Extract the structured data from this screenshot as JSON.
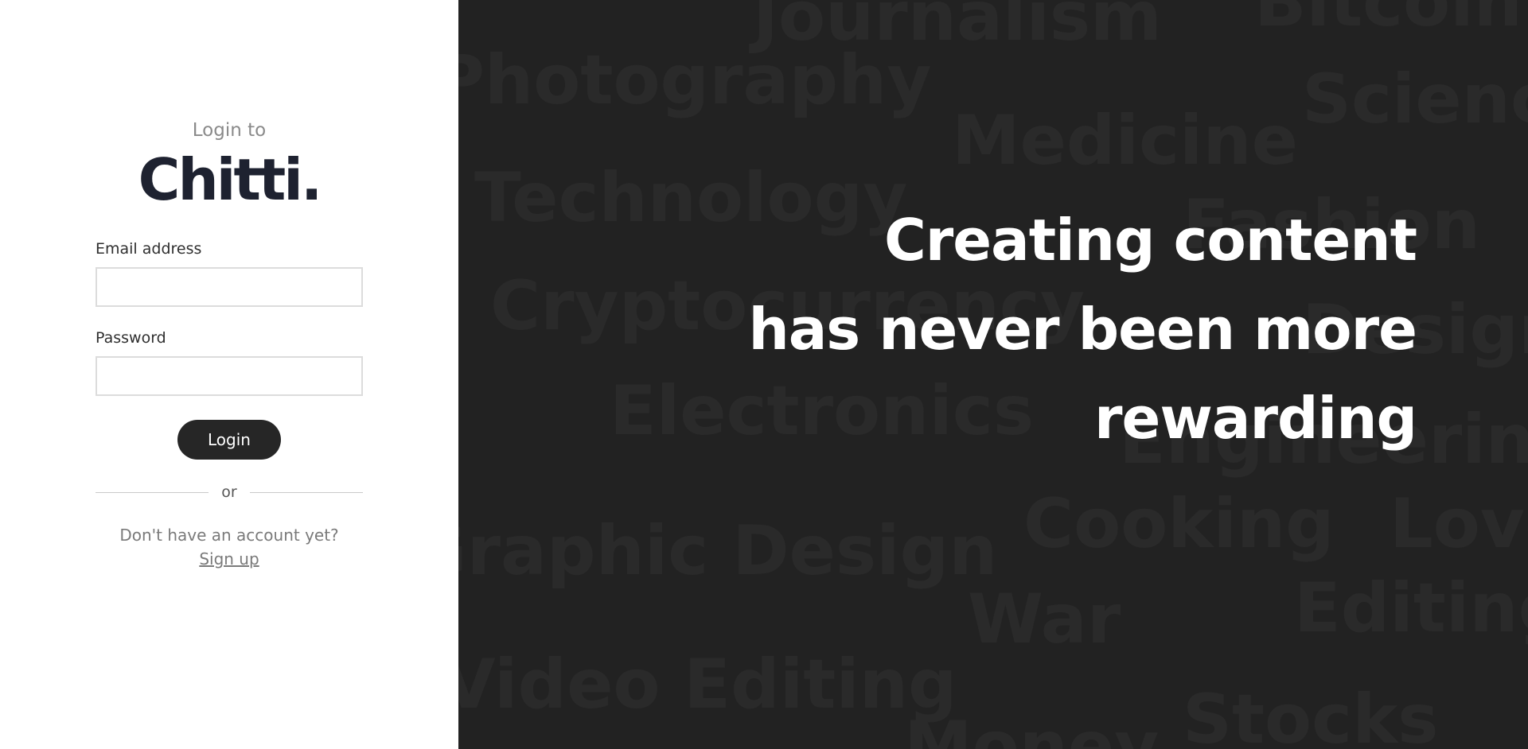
{
  "login": {
    "kicker": "Login to",
    "brand": "Chitti.",
    "email_label": "Email address",
    "email_value": "",
    "password_label": "Password",
    "password_value": "",
    "login_button": "Login",
    "or_text": "or",
    "signup_prompt": "Don't have an account yet?",
    "signup_link": "Sign up"
  },
  "hero": {
    "tagline_lines": [
      "Creating content",
      "has never been more",
      "rewarding"
    ],
    "background_words": [
      "Journalism",
      "Bitcoin",
      "Photography",
      "Science",
      "Medicine",
      "Technology",
      "Fashion",
      "Cryptocurrency",
      "Design",
      "Electronics",
      "Engineering",
      "Cooking",
      "Love",
      "Graphic Design",
      "War",
      "Editing",
      "Video Editing",
      "Stocks",
      "Money"
    ]
  },
  "colors": {
    "hero_background": "#222222",
    "background_word": "#2a2a2a",
    "tagline": "#ffffff",
    "button": "#262626",
    "brand": "#1e2230"
  }
}
